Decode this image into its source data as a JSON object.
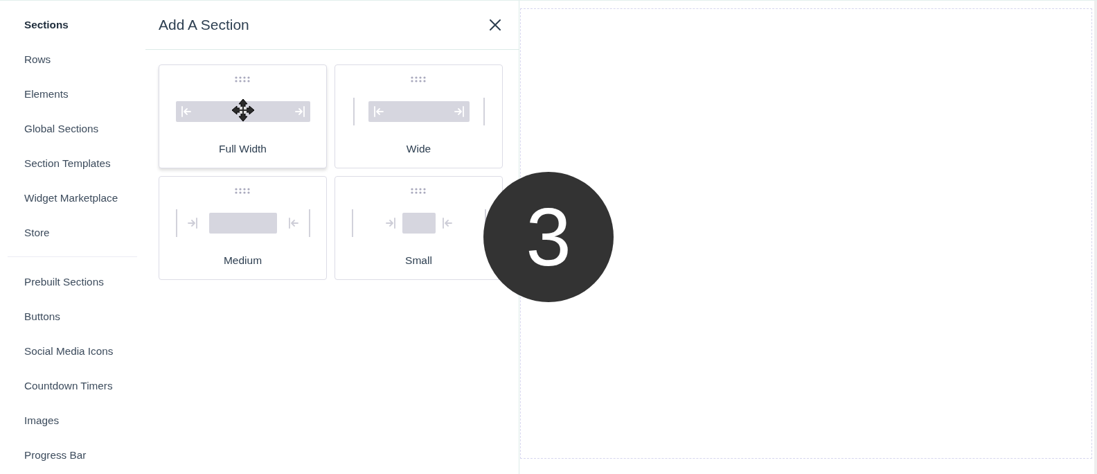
{
  "sidebar": {
    "groups": [
      {
        "items": [
          {
            "label": "Sections",
            "selected": true
          },
          {
            "label": "Rows",
            "selected": false
          },
          {
            "label": "Elements",
            "selected": false
          },
          {
            "label": "Global Sections",
            "selected": false
          },
          {
            "label": "Section Templates",
            "selected": false
          },
          {
            "label": "Widget Marketplace",
            "selected": false
          },
          {
            "label": "Store",
            "selected": false
          }
        ]
      },
      {
        "items": [
          {
            "label": "Prebuilt Sections",
            "selected": false
          },
          {
            "label": "Buttons",
            "selected": false
          },
          {
            "label": "Social Media Icons",
            "selected": false
          },
          {
            "label": "Countdown Timers",
            "selected": false
          },
          {
            "label": "Images",
            "selected": false
          },
          {
            "label": "Progress Bar",
            "selected": false
          }
        ]
      }
    ]
  },
  "panel": {
    "title": "Add A Section",
    "cards": [
      {
        "label": "Full Width",
        "kind": "full",
        "hovered": true
      },
      {
        "label": "Wide",
        "kind": "wide",
        "hovered": false
      },
      {
        "label": "Medium",
        "kind": "medium",
        "hovered": false
      },
      {
        "label": "Small",
        "kind": "small",
        "hovered": false
      }
    ]
  },
  "step_marker": {
    "number": "3"
  }
}
